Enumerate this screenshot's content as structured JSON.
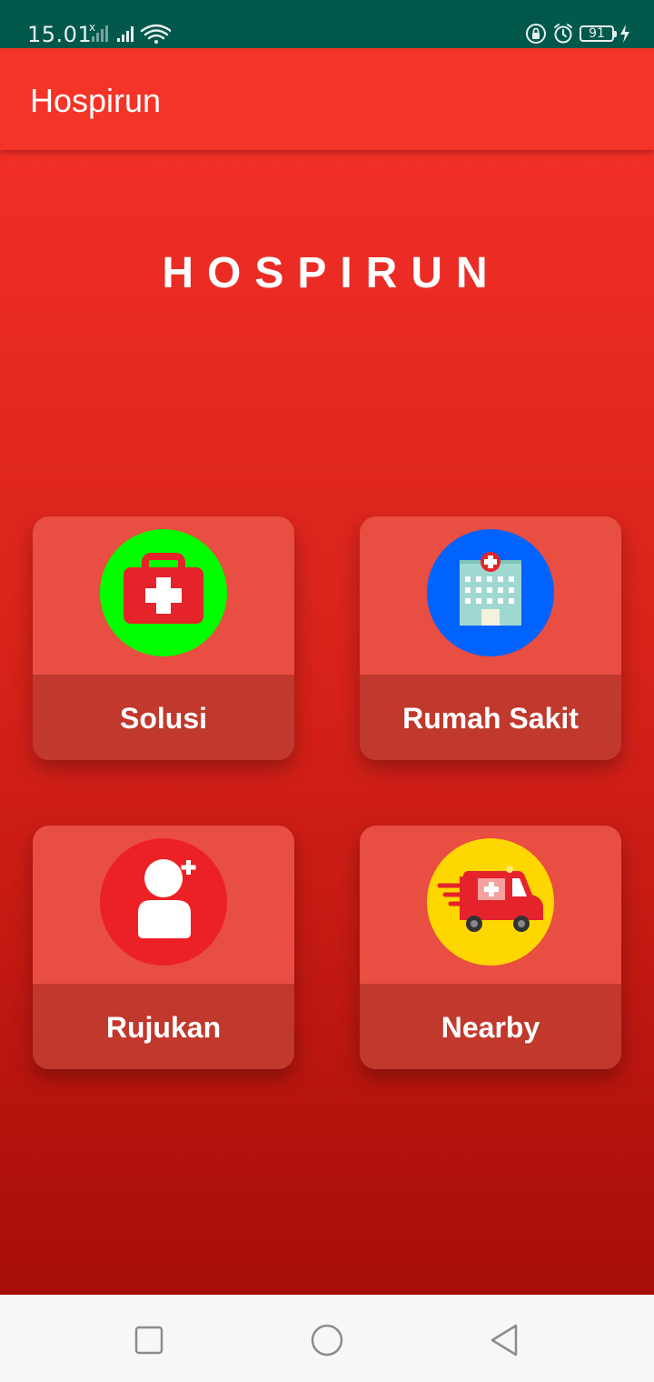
{
  "status_bar": {
    "time": "15.01",
    "battery": "91"
  },
  "app_bar": {
    "title": "Hospirun"
  },
  "hero": {
    "title": "HOSPIRUN"
  },
  "menu": [
    {
      "label": "Solusi",
      "icon": "first-aid-kit-icon",
      "circle_color": "#00ff00"
    },
    {
      "label": "Rumah Sakit",
      "icon": "hospital-building-icon",
      "circle_color": "#0062ff"
    },
    {
      "label": "Rujukan",
      "icon": "add-person-icon",
      "circle_color": "#ec2125"
    },
    {
      "label": "Nearby",
      "icon": "ambulance-icon",
      "circle_color": "#ffd700"
    }
  ],
  "nav_bar": {
    "buttons": [
      "recent-apps-icon",
      "home-icon",
      "back-icon"
    ]
  },
  "colors": {
    "status_bar": "#03584c",
    "app_bar": "#f43427",
    "card": "#e84e41",
    "card_label_bg": "#c1382c"
  }
}
